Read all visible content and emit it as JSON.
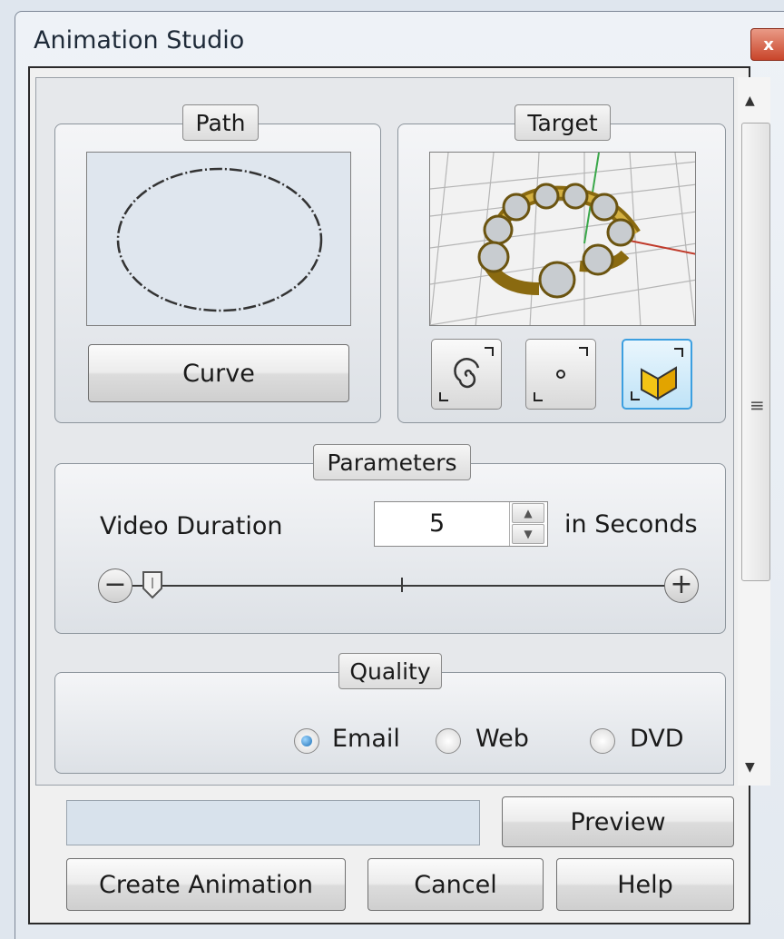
{
  "window": {
    "title": "Animation Studio",
    "close_symbol": "x"
  },
  "path_group": {
    "label": "Path",
    "curve_button": "Curve"
  },
  "target_group": {
    "label": "Target",
    "mode_buttons": [
      {
        "icon": "spiral-icon",
        "active": false
      },
      {
        "icon": "point-icon",
        "active": false
      },
      {
        "icon": "box-icon",
        "active": true
      }
    ]
  },
  "parameters_group": {
    "label": "Parameters",
    "duration_label": "Video Duration",
    "duration_value": "5",
    "duration_unit": "in Seconds",
    "decrease_symbol": "−",
    "increase_symbol": "+"
  },
  "quality_group": {
    "label": "Quality",
    "options": [
      {
        "label": "Email",
        "selected": true
      },
      {
        "label": "Web",
        "selected": false
      },
      {
        "label": "DVD",
        "selected": false
      }
    ]
  },
  "footer": {
    "preview_button": "Preview",
    "create_button": "Create Animation",
    "cancel_button": "Cancel",
    "help_button": "Help"
  },
  "colors": {
    "accent": "#3c9fe0",
    "close_button": "#c9452a"
  }
}
